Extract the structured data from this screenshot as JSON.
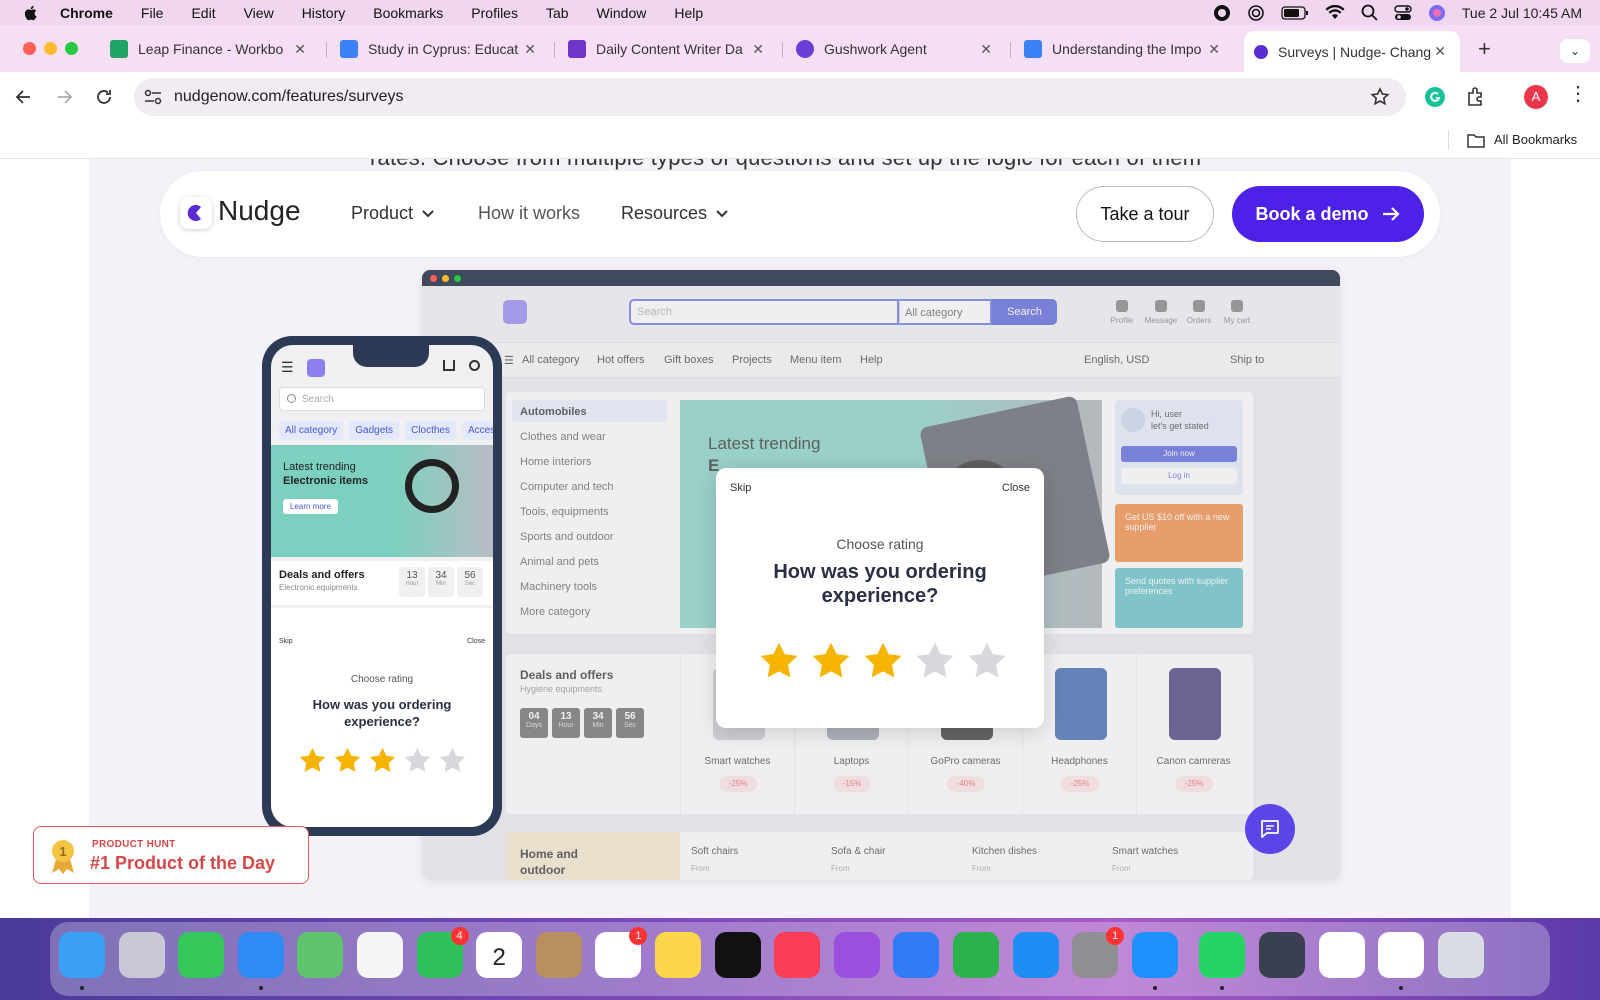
{
  "menubar": {
    "app": "Chrome",
    "items": [
      "File",
      "Edit",
      "View",
      "History",
      "Bookmarks",
      "Profiles",
      "Tab",
      "Window",
      "Help"
    ],
    "datetime": "Tue 2 Jul  10:45 AM"
  },
  "tabs": [
    {
      "label": "Leap Finance - Workbo",
      "icon_color": "#1fa463",
      "icon": "sheets-icon"
    },
    {
      "label": "Study in Cyprus: Educat",
      "icon_color": "#3b82f6",
      "icon": "docs-icon"
    },
    {
      "label": "Daily Content Writer Da",
      "icon_color": "#6d35c9",
      "icon": "forms-icon"
    },
    {
      "label": "Gushwork Agent",
      "icon_color": "#6b3fd6",
      "icon": "gushwork-icon"
    },
    {
      "label": "Understanding the Impo",
      "icon_color": "#3b82f6",
      "icon": "docs-icon"
    },
    {
      "label": "Surveys | Nudge- Chang",
      "icon_color": "#5b2bd6",
      "icon": "nudge-icon",
      "active": true
    }
  ],
  "toolbar": {
    "url": "nudgenow.com/features/surveys",
    "profile_initial": "A"
  },
  "bookmarks": {
    "all_label": "All Bookmarks"
  },
  "page": {
    "cut_text": "rates. Choose from multiple types of questions and set up the logic for each of them",
    "nav": {
      "logo": "Nudge",
      "product": "Product",
      "how": "How it works",
      "resources": "Resources",
      "tour": "Take a tour",
      "demo": "Book a demo"
    },
    "shop": {
      "search_placeholder": "Search",
      "category": "All category",
      "search_btn": "Search",
      "header_icons": [
        "Profile",
        "Message",
        "Orders",
        "My cart"
      ],
      "nav": [
        "All category",
        "Hot offers",
        "Gift boxes",
        "Projects",
        "Menu item",
        "Help"
      ],
      "lang": "English, USD",
      "ship": "Ship to",
      "sidebar": [
        "Automobiles",
        "Clothes and wear",
        "Home interiors",
        "Computer and tech",
        "Tools, equipments",
        "Sports and outdoor",
        "Animal and pets",
        "Machinery tools",
        "More category"
      ],
      "hero": "Latest trending",
      "hero2": "E",
      "user_card": {
        "greet": "Hi, user\nlet's get stated",
        "join": "Join now",
        "login": "Log in"
      },
      "promo1": "Get US $10 off with a new supplier",
      "promo2": "Send quotes with supplier preferences",
      "deals_title": "Deals and offers",
      "deals_sub": "Hygiene equipments",
      "timer": [
        {
          "v": "04",
          "u": "Days"
        },
        {
          "v": "13",
          "u": "Hour"
        },
        {
          "v": "34",
          "u": "Min"
        },
        {
          "v": "56",
          "u": "Sec"
        }
      ],
      "products": [
        {
          "name": "Smart watches",
          "off": "-25%"
        },
        {
          "name": "Laptops",
          "off": "-15%"
        },
        {
          "name": "GoPro cameras",
          "off": "-40%"
        },
        {
          "name": "Headphones",
          "off": "-25%"
        },
        {
          "name": "Canon camreras",
          "off": "-25%"
        }
      ],
      "bottom": {
        "title": "Home and outdoor",
        "items": [
          "Soft chairs",
          "Sofa & chair",
          "Kitchen dishes",
          "Smart watches"
        ],
        "from": "From"
      }
    },
    "modal": {
      "skip": "Skip",
      "close": "Close",
      "sub": "Choose rating",
      "question": "How was you ordering experience?",
      "rating": 3,
      "max": 5
    },
    "phone": {
      "search": "Search",
      "chips": [
        "All category",
        "Gadgets",
        "Clocthes",
        "Accessory"
      ],
      "hero1": "Latest trending",
      "hero2": "Electronic items",
      "learn": "Learn more",
      "deals": "Deals and offers",
      "deals_sub": "Electronic equipments",
      "timer": [
        {
          "v": "13",
          "u": "Hour"
        },
        {
          "v": "34",
          "u": "Min"
        },
        {
          "v": "56",
          "u": "Sec"
        }
      ],
      "skip": "Skip",
      "close": "Close",
      "sub": "Choose rating",
      "question": "How was you ordering experience?"
    },
    "badge": {
      "l1": "PRODUCT HUNT",
      "l2": "#1 Product of the Day"
    }
  },
  "dock": [
    {
      "name": "finder-icon",
      "color": "#3aa0f5",
      "dot": true
    },
    {
      "name": "launchpad-icon",
      "color": "#c9c9d6"
    },
    {
      "name": "messages-icon",
      "color": "#34c759"
    },
    {
      "name": "mail-icon",
      "color": "#2f8af5",
      "dot": true
    },
    {
      "name": "maps-icon",
      "color": "#5fc46b"
    },
    {
      "name": "photos-icon",
      "color": "#f5f5f5"
    },
    {
      "name": "facetime-icon",
      "color": "#2fc25b",
      "badge": "4"
    },
    {
      "name": "calendar-icon",
      "color": "#ffffff",
      "text": "2"
    },
    {
      "name": "contacts-icon",
      "color": "#b89060"
    },
    {
      "name": "reminders-icon",
      "color": "#ffffff",
      "badge": "1"
    },
    {
      "name": "notes-icon",
      "color": "#fbd54a"
    },
    {
      "name": "appletv-icon",
      "color": "#111111"
    },
    {
      "name": "music-icon",
      "color": "#fa3e55"
    },
    {
      "name": "podcasts-icon",
      "color": "#9a4fe0"
    },
    {
      "name": "keynote-icon",
      "color": "#2f7cf6"
    },
    {
      "name": "numbers-icon",
      "color": "#2bb24c"
    },
    {
      "name": "appstore-icon",
      "color": "#1e8ef5"
    },
    {
      "name": "settings-icon",
      "color": "#8e8e93",
      "badge": "1"
    },
    {
      "name": "safari-icon",
      "color": "#1e90ff",
      "dot": true
    },
    {
      "name": "whatsapp-icon",
      "color": "#25d366",
      "dot": true
    },
    {
      "name": "quicktime-icon",
      "color": "#3a4050"
    },
    {
      "name": "slack-icon",
      "color": "#ffffff"
    },
    {
      "name": "chrome-icon",
      "color": "#ffffff",
      "dot": true
    },
    {
      "name": "trash-icon",
      "color": "#d9dde3"
    }
  ]
}
